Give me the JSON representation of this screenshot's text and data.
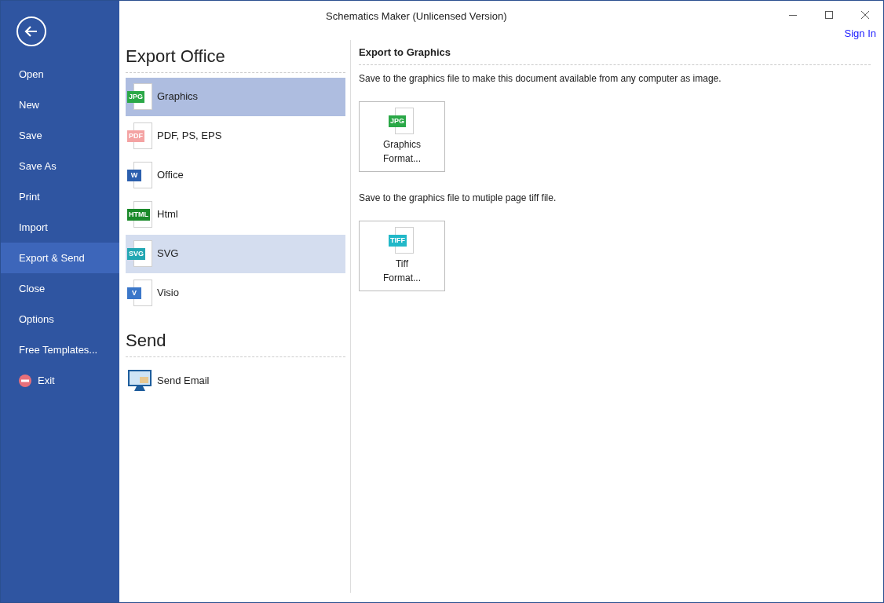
{
  "window": {
    "title": "Schematics Maker (Unlicensed Version)",
    "sign_in": "Sign In"
  },
  "sidebar": {
    "items": [
      {
        "label": "Open",
        "kind": "text",
        "selected": false
      },
      {
        "label": "New",
        "kind": "text",
        "selected": false
      },
      {
        "label": "Save",
        "kind": "text",
        "selected": false
      },
      {
        "label": "Save As",
        "kind": "text",
        "selected": false
      },
      {
        "label": "Print",
        "kind": "text",
        "selected": false
      },
      {
        "label": "Import",
        "kind": "text",
        "selected": false
      },
      {
        "label": "Export & Send",
        "kind": "text",
        "selected": true
      },
      {
        "label": "Close",
        "kind": "text",
        "selected": false
      },
      {
        "label": "Options",
        "kind": "text",
        "selected": false
      },
      {
        "label": "Free Templates...",
        "kind": "text",
        "selected": false
      },
      {
        "label": "Exit",
        "kind": "exit",
        "selected": false
      }
    ]
  },
  "export_section": {
    "title": "Export Office",
    "items": [
      {
        "label": "Graphics",
        "badge": "JPG",
        "color": "#2aa847",
        "selected": true,
        "hovered": false
      },
      {
        "label": "PDF, PS, EPS",
        "badge": "PDF",
        "color": "#f4a3a3",
        "selected": false,
        "hovered": false
      },
      {
        "label": "Office",
        "badge": "W",
        "color": "#2b5fae",
        "selected": false,
        "hovered": false
      },
      {
        "label": "Html",
        "badge": "HTML",
        "color": "#1a8a2a",
        "selected": false,
        "hovered": false
      },
      {
        "label": "SVG",
        "badge": "SVG",
        "color": "#22a7b3",
        "selected": false,
        "hovered": true
      },
      {
        "label": "Visio",
        "badge": "V",
        "color": "#3b77c9",
        "selected": false,
        "hovered": false
      }
    ]
  },
  "send_section": {
    "title": "Send",
    "items": [
      {
        "label": "Send Email"
      }
    ]
  },
  "detail": {
    "title": "Export to Graphics",
    "groups": [
      {
        "description": "Save to the graphics file to make this document available from any computer as image.",
        "button": {
          "badge": "JPG",
          "color": "#2aa847",
          "lines": [
            "Graphics",
            "Format..."
          ]
        }
      },
      {
        "description": "Save to the graphics file to mutiple page tiff file.",
        "button": {
          "badge": "TIFF",
          "color": "#22b8c8",
          "lines": [
            "Tiff",
            "Format..."
          ]
        }
      }
    ]
  }
}
